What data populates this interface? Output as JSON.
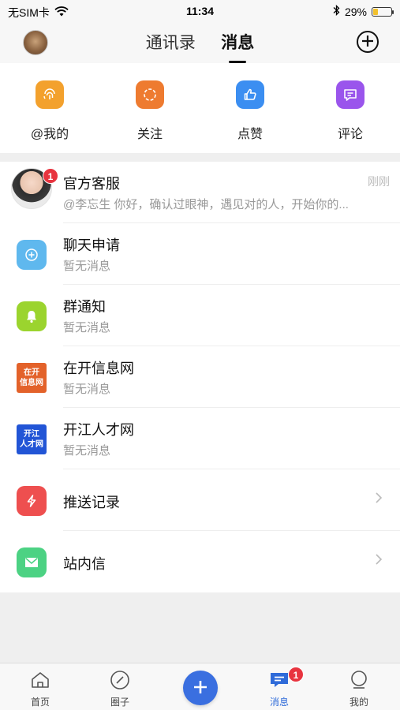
{
  "status_bar": {
    "carrier": "无SIM卡",
    "time": "11:34",
    "battery": "29%",
    "battery_level": 0.29
  },
  "nav": {
    "tabs": [
      "通讯录",
      "消息"
    ],
    "active_tab": "消息"
  },
  "quick_actions": [
    {
      "label": "@我的",
      "icon": "fingerprint-icon",
      "color": "#f3a12d"
    },
    {
      "label": "关注",
      "icon": "loading-ring-icon",
      "color": "#ee7b30"
    },
    {
      "label": "点赞",
      "icon": "thumbs-up-icon",
      "color": "#3b8ef1"
    },
    {
      "label": "评论",
      "icon": "comment-icon",
      "color": "#9a55ec"
    }
  ],
  "messages": [
    {
      "title": "官方客服",
      "subtitle": "@李忘生 你好，确认过眼神，遇见对的人，开始你的...",
      "time": "刚刚",
      "badge": "1",
      "icon": "customer-service-avatar"
    },
    {
      "title": "聊天申请",
      "subtitle": "暂无消息",
      "icon": "add-chat-icon",
      "color": "#5fb8ee"
    },
    {
      "title": "群通知",
      "subtitle": "暂无消息",
      "icon": "bell-icon",
      "color": "#9bd42e"
    },
    {
      "title": "在开信息网",
      "subtitle": "暂无消息",
      "icon": "zaikai-logo",
      "logo_text": [
        "在开",
        "信息网"
      ],
      "color": "#e3622a"
    },
    {
      "title": "开江人才网",
      "subtitle": "暂无消息",
      "icon": "kaijiang-logo",
      "logo_text": [
        "开江",
        "人才网"
      ],
      "color": "#2255d6"
    },
    {
      "title": "推送记录",
      "icon": "push-bolt-icon",
      "color": "#ee4f4f"
    },
    {
      "title": "站内信",
      "icon": "envelope-icon",
      "color": "#4cd283"
    }
  ],
  "tabbar": {
    "items": [
      {
        "label": "首页",
        "icon": "home-icon"
      },
      {
        "label": "圈子",
        "icon": "compass-icon"
      },
      {
        "label": "消息",
        "icon": "message-icon",
        "badge": "1",
        "active": true
      },
      {
        "label": "我的",
        "icon": "profile-icon"
      }
    ],
    "fab": "+"
  }
}
